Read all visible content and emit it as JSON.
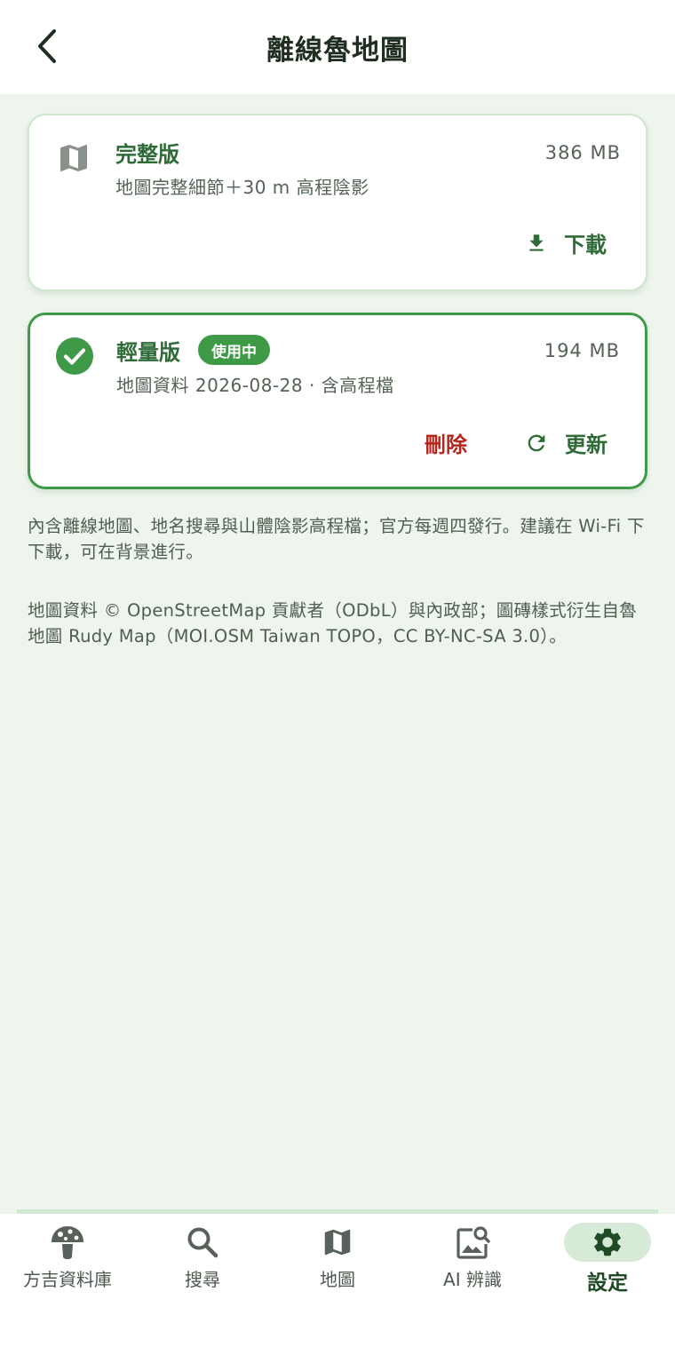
{
  "header": {
    "title": "離線魯地圖",
    "back_icon": "chevron-left-icon"
  },
  "cards": [
    {
      "icon": "map-icon",
      "title": "完整版",
      "size": "386 MB",
      "description": "地圖完整細節＋30 m 高程陰影",
      "actions": {
        "download": "下載"
      }
    },
    {
      "icon": "check-circle-icon",
      "title": "輕量版",
      "badge": "使用中",
      "size": "194 MB",
      "description": "地圖資料 2026-08-28 · 含高程檔",
      "actions": {
        "delete": "刪除",
        "update": "更新"
      }
    }
  ],
  "notes": {
    "info": "內含離線地圖、地名搜尋與山體陰影高程檔；官方每週四發行。建議在 Wi-Fi 下下載，可在背景進行。",
    "attribution": "地圖資料 © OpenStreetMap 貢獻者（ODbL）與內政部；圖磚樣式衍生自魯地圖 Rudy Map（MOI.OSM Taiwan TOPO，CC BY-NC-SA 3.0）。"
  },
  "nav": {
    "items": [
      {
        "label": "方吉資料庫",
        "icon": "mushroom-icon",
        "active": false
      },
      {
        "label": "搜尋",
        "icon": "search-icon",
        "active": false
      },
      {
        "label": "地圖",
        "icon": "map-icon",
        "active": false
      },
      {
        "label": "AI 辨識",
        "icon": "image-search-icon",
        "active": false
      },
      {
        "label": "設定",
        "icon": "gear-icon",
        "active": true
      }
    ]
  },
  "colors": {
    "accent": "#2e6b36",
    "active_border": "#3f9a48",
    "danger": "#b3261e",
    "background": "#edf5ec"
  }
}
